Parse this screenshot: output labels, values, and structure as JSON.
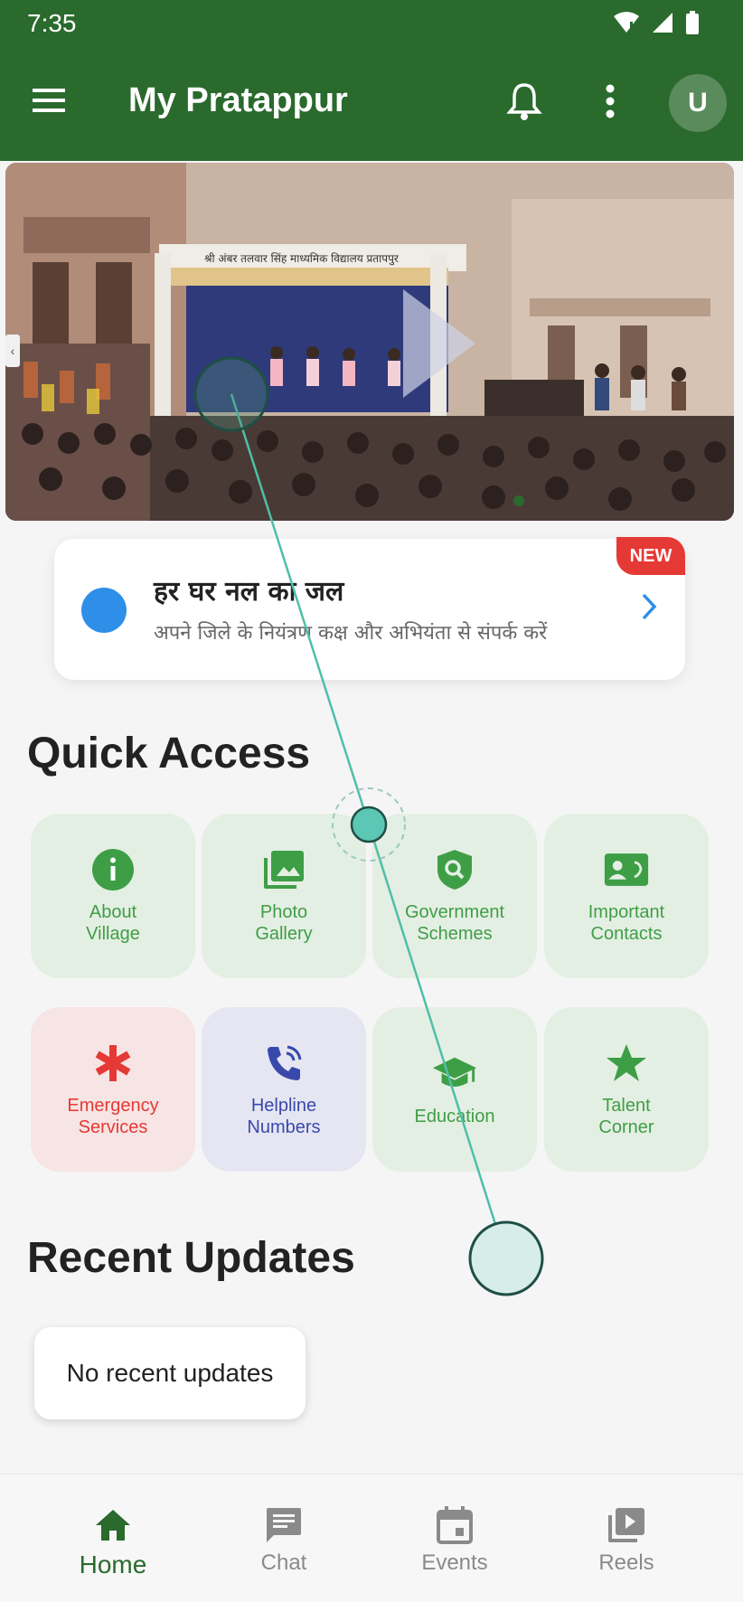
{
  "status_bar": {
    "time": "7:35"
  },
  "app_bar": {
    "title": "My Pratappur",
    "avatar_initial": "U"
  },
  "banner": {
    "sign_text": "श्री अंबर तलवार सिंह माध्यमिक विद्यालय प्रतापपुर"
  },
  "notice": {
    "badge": "NEW",
    "title": "हर घर नल का जल",
    "subtitle": "अपने जिले के नियंत्रण कक्ष और अभियंता से संपर्क करें"
  },
  "quick_access": {
    "heading": "Quick Access",
    "tiles": [
      {
        "label": "About\nVillage",
        "icon": "info-icon"
      },
      {
        "label": "Photo\nGallery",
        "icon": "photo-library-icon"
      },
      {
        "label": "Government\nSchemes",
        "icon": "shield-search-icon"
      },
      {
        "label": "Important\nContacts",
        "icon": "contact-card-icon"
      },
      {
        "label": "Emergency\nServices",
        "icon": "asterisk-icon"
      },
      {
        "label": "Helpline\nNumbers",
        "icon": "phone-call-icon"
      },
      {
        "label": "Education",
        "icon": "graduation-cap-icon"
      },
      {
        "label": "Talent\nCorner",
        "icon": "star-icon"
      }
    ]
  },
  "recent_updates": {
    "heading": "Recent Updates",
    "empty_text": "No recent updates"
  },
  "bottom_nav": {
    "items": [
      {
        "label": "Home",
        "icon": "home-icon",
        "active": true
      },
      {
        "label": "Chat",
        "icon": "chat-icon",
        "active": false
      },
      {
        "label": "Events",
        "icon": "calendar-icon",
        "active": false
      },
      {
        "label": "Reels",
        "icon": "video-library-icon",
        "active": false
      }
    ]
  },
  "colors": {
    "primary": "#2a6a2d",
    "tile_green_bg": "#e4efe3",
    "tile_green_fg": "#3e9e46",
    "tile_red_bg": "#f7e4e4",
    "tile_red_fg": "#e53935",
    "tile_blue_bg": "#e5e6f2",
    "tile_blue_fg": "#3949ab",
    "badge": "#e53935",
    "notice_dot": "#2d8fe8"
  }
}
